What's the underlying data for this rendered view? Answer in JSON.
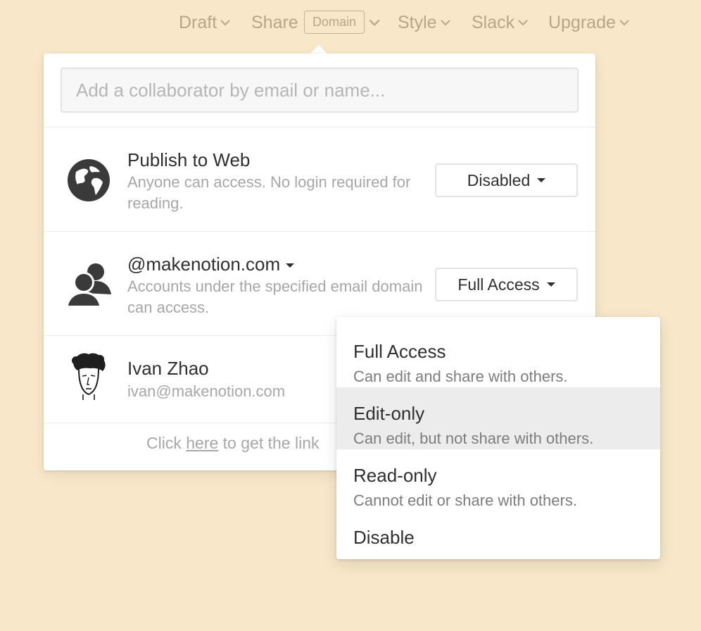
{
  "nav": {
    "draft": "Draft",
    "share": "Share",
    "domain_badge": "Domain",
    "style": "Style",
    "slack": "Slack",
    "upgrade": "Upgrade"
  },
  "share_panel": {
    "invite_placeholder": "Add a collaborator by email or name...",
    "publish": {
      "title": "Publish to Web",
      "desc": "Anyone can access. No login required for reading.",
      "select_value": "Disabled",
      "icon": "globe-icon"
    },
    "domain": {
      "title": "@makenotion.com",
      "desc": "Accounts under the specified email domain can access.",
      "select_value": "Full Access",
      "icon": "group-icon"
    },
    "user": {
      "name": "Ivan Zhao",
      "email": "ivan@makenotion.com",
      "icon": "avatar"
    },
    "footer": {
      "prefix": "Click ",
      "link": "here",
      "suffix": " to get the link"
    }
  },
  "access_menu": {
    "items": [
      {
        "label": "Full Access",
        "desc": "Can edit and share with others."
      },
      {
        "label": "Edit-only",
        "desc": "Can edit, but not share with others.",
        "highlighted": true
      },
      {
        "label": "Read-only",
        "desc": "Cannot edit or share with others."
      },
      {
        "label": "Disable",
        "desc": ""
      }
    ]
  },
  "colors": {
    "background": "#f8e8c9",
    "nav_text": "#b7a688",
    "highlight": "#ececec"
  }
}
